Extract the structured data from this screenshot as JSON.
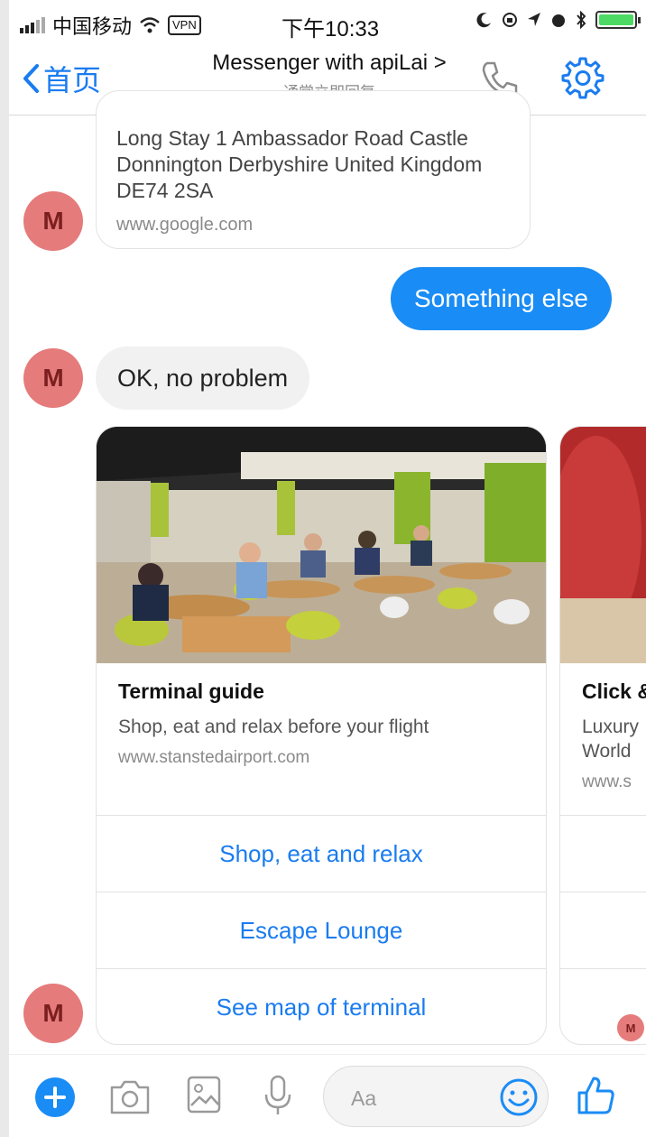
{
  "status_bar": {
    "carrier": "中国移动",
    "vpn": "VPN",
    "time": "下午10:33"
  },
  "nav": {
    "back_label": "首页",
    "title": "Messenger with apiLai",
    "title_chevron": ">",
    "subtitle": "通常立即回复"
  },
  "messages": {
    "avatar_letter": "M",
    "address_card": {
      "address": "Long Stay 1 Ambassador Road Castle Donnington Derbyshire United Kingdom DE74 2SA",
      "url": "www.google.com"
    },
    "outgoing_text": "Something else",
    "incoming_text": "OK, no problem"
  },
  "carousel": {
    "cards": [
      {
        "title": "Terminal guide",
        "subtitle": "Shop, eat and relax before your flight",
        "url": "www.stanstedairport.com",
        "buttons": [
          "Shop, eat and relax",
          "Escape Lounge",
          "See map of terminal"
        ]
      },
      {
        "title": "Click &",
        "subtitle": "Luxury World",
        "url": "www.s"
      }
    ]
  },
  "composer": {
    "placeholder": "Aa"
  },
  "colors": {
    "accent": "#1a8cf5",
    "link": "#1a7cf0",
    "avatar": "#e57b7b"
  },
  "icons": [
    "back-chevron-icon",
    "phone-icon",
    "settings-gear-icon",
    "plus-icon",
    "camera-icon",
    "image-icon",
    "microphone-icon",
    "emoji-icon",
    "thumbs-up-icon"
  ]
}
